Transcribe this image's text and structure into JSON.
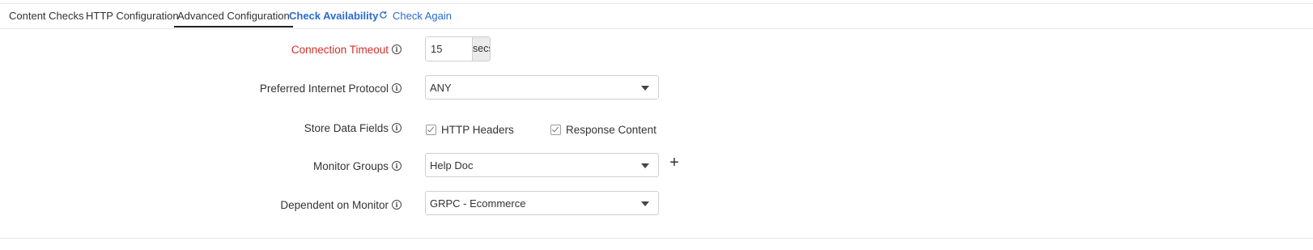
{
  "tabs": [
    {
      "label": "Content Checks"
    },
    {
      "label": "HTTP Configuration"
    },
    {
      "label": "Advanced Configuration",
      "active": true
    },
    {
      "label": "Check Availability"
    },
    {
      "label": "Check Again"
    }
  ],
  "fields": {
    "connection_timeout": {
      "label": "Connection Timeout",
      "value": "15",
      "unit": "secs",
      "required_color": "#d0302a"
    },
    "preferred_protocol": {
      "label": "Preferred Internet Protocol",
      "value": "ANY"
    },
    "store_data_fields": {
      "label": "Store Data Fields",
      "options": [
        {
          "label": "HTTP Headers",
          "checked": true
        },
        {
          "label": "Response Content",
          "checked": true
        }
      ]
    },
    "monitor_groups": {
      "label": "Monitor Groups",
      "value": "Help Doc",
      "add_label": "+"
    },
    "dependent_on_monitor": {
      "label": "Dependent on Monitor",
      "value": "GRPC - Ecommerce"
    }
  },
  "icons": {
    "info": "info-circle-icon",
    "refresh": "refresh-icon",
    "caret": "caret-down-icon",
    "add": "plus-icon"
  },
  "colors": {
    "link": "#2a6bd1",
    "required": "#d0302a",
    "border": "#cfcfcf"
  }
}
